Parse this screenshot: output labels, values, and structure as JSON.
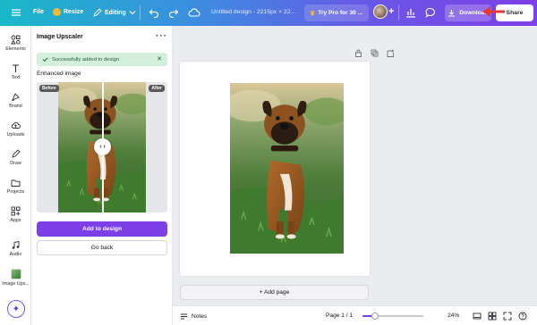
{
  "topbar": {
    "file_label": "File",
    "resize_label": "Resize",
    "editing_label": "Editing",
    "doc_title": "Untitled design - 2215px × 22...",
    "try_pro_label": "Try Pro for 30 ...",
    "download_label": "Download",
    "share_label": "Share",
    "icons": [
      "menu-icon",
      "pencil-icon",
      "chevron-down-icon",
      "undo-icon",
      "redo-icon",
      "cloud-icon",
      "crown-icon",
      "plus-icon",
      "chart-icon",
      "comment-icon",
      "download-icon",
      "arrow-icon"
    ]
  },
  "rail": {
    "items": [
      {
        "label": "Elements",
        "icon": "elements-icon"
      },
      {
        "label": "Text",
        "icon": "text-icon"
      },
      {
        "label": "Brand",
        "icon": "brand-icon"
      },
      {
        "label": "Uploads",
        "icon": "upload-cloud-icon"
      },
      {
        "label": "Draw",
        "icon": "draw-icon"
      },
      {
        "label": "Projects",
        "icon": "folder-icon"
      },
      {
        "label": "Apps",
        "icon": "apps-icon"
      },
      {
        "label": "Audio",
        "icon": "music-icon"
      },
      {
        "label": "Image Ups...",
        "icon": "image-upscaler-thumb"
      }
    ]
  },
  "panel": {
    "title": "Image Upscaler",
    "toast": "Successfully added to design",
    "enhanced_label": "Enhanced image",
    "before_label": "Before",
    "after_label": "After",
    "add_button": "Add to design",
    "back_button": "Go back"
  },
  "canvas": {
    "add_page_label": "+ Add page"
  },
  "bottombar": {
    "notes_label": "Notes",
    "page_indicator": "Page 1 / 1",
    "zoom_value": "24%",
    "zoom_fraction": 0.2
  },
  "colors": {
    "accent": "#7d3fe6",
    "toast_bg": "#d4f0dc",
    "canvas_bg": "#ebecf0"
  }
}
